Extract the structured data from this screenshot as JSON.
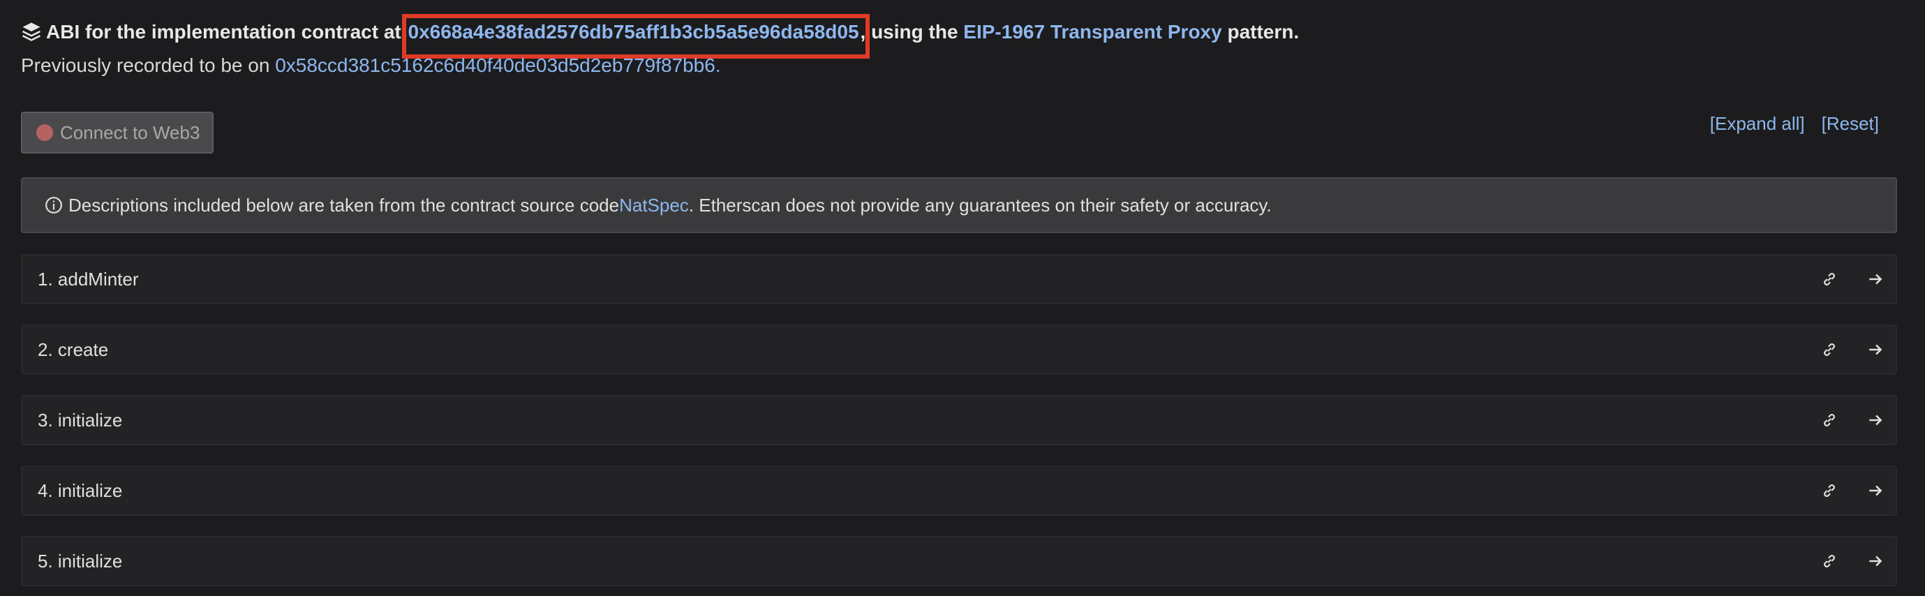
{
  "header": {
    "prefix": "ABI for the implementation contract at ",
    "implementation_address": "0x668a4e38fad2576db75aff1b3cb5a5e96da58d05",
    "comma": ",",
    "middle": " using the ",
    "proxy_pattern_link": "EIP-1967 Transparent Proxy",
    "suffix": " pattern.",
    "previous_prefix": "Previously recorded to be on ",
    "previous_address": "0x58ccd381c5162c6d40f40de03d5d2eb779f87bb6",
    "previous_suffix": "."
  },
  "toolbar": {
    "connect_label": "Connect to Web3",
    "expand_all": "[Expand all]",
    "reset": "[Reset]"
  },
  "notice": {
    "prefix": "Descriptions included below are taken from the contract source code ",
    "natspec_link": "NatSpec",
    "suffix": ". Etherscan does not provide any guarantees on their safety or accuracy."
  },
  "functions": [
    {
      "label": "1. addMinter"
    },
    {
      "label": "2. create"
    },
    {
      "label": "3. initialize"
    },
    {
      "label": "4. initialize"
    },
    {
      "label": "5. initialize"
    }
  ],
  "colors": {
    "link": "#8fb7ee",
    "highlight": "#e03a28",
    "status_dot": "#b56362"
  },
  "icons": {
    "header": "layers-icon",
    "notice": "info-circle-icon",
    "row_link": "link-icon",
    "row_arrow": "arrow-right-icon"
  }
}
